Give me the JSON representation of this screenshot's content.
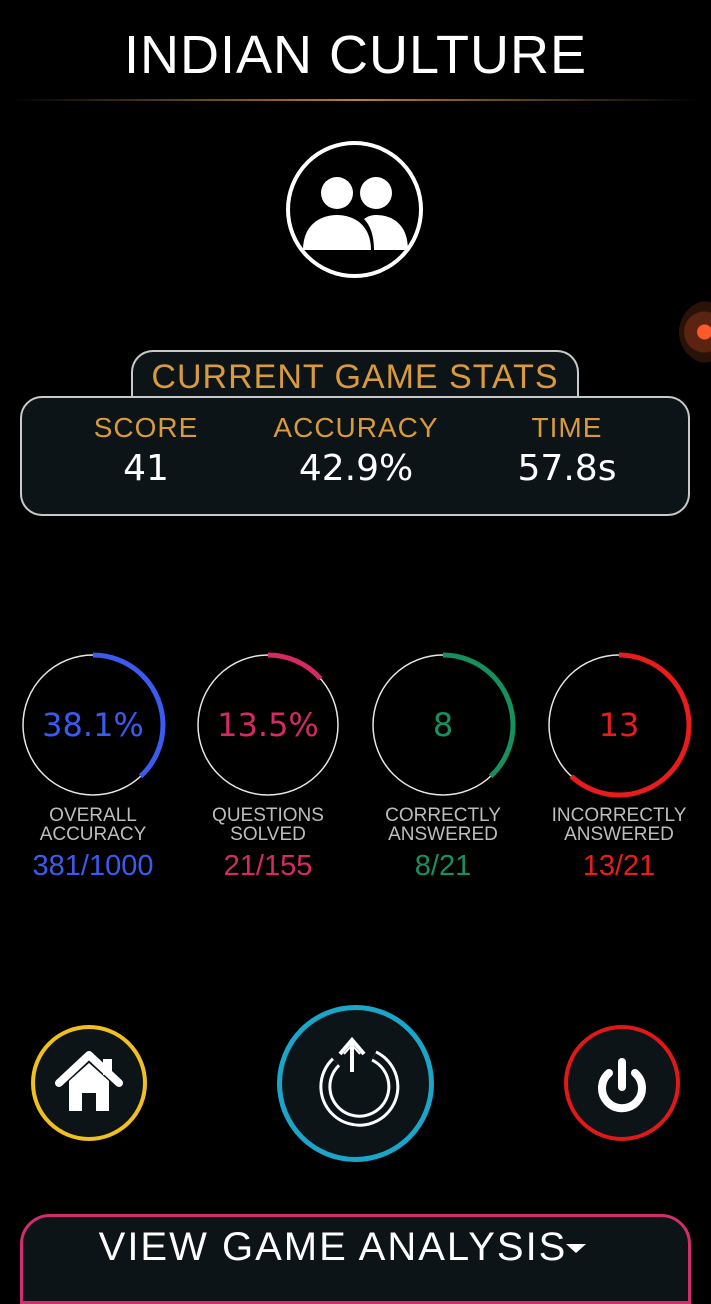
{
  "header": {
    "title": "INDIAN CULTURE"
  },
  "avatar": {
    "icon": "group-icon"
  },
  "current_stats": {
    "heading": "CURRENT GAME STATS",
    "items": [
      {
        "label": "SCORE",
        "value": "41"
      },
      {
        "label": "ACCURACY",
        "value": "42.9%"
      },
      {
        "label": "TIME",
        "value": "57.8s"
      }
    ]
  },
  "rings": [
    {
      "center": "38.1%",
      "caption_line1": "OVERALL",
      "caption_line2": "ACCURACY",
      "fraction": "381/1000",
      "color": "#3b5bf0",
      "progress": 0.381
    },
    {
      "center": "13.5%",
      "caption_line1": "QUESTIONS",
      "caption_line2": "SOLVED",
      "fraction": "21/155",
      "color": "#d62a66",
      "progress": 0.135
    },
    {
      "center": "8",
      "caption_line1": "CORRECTLY",
      "caption_line2": "ANSWERED",
      "fraction": "8/21",
      "color": "#179060",
      "progress": 0.381
    },
    {
      "center": "13",
      "caption_line1": "INCORRECTLY",
      "caption_line2": "ANSWERED",
      "fraction": "13/21",
      "color": "#e81c1c",
      "progress": 0.619
    }
  ],
  "actions": {
    "home": {
      "icon": "home-icon",
      "color": "#f0c020"
    },
    "replay": {
      "icon": "replay-icon",
      "color": "#1aa5c9"
    },
    "power": {
      "icon": "power-icon",
      "color": "#e01818"
    }
  },
  "analysis": {
    "label": "VIEW GAME ANALYSIS",
    "icon": "caret-down-icon",
    "color": "#d12e6c"
  }
}
